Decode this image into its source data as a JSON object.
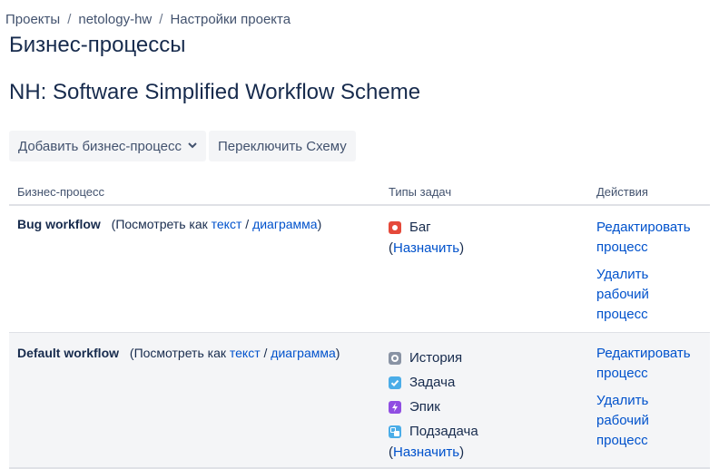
{
  "breadcrumb": {
    "items": [
      "Проекты",
      "netology-hw",
      "Настройки проекта"
    ],
    "separator": "/"
  },
  "page_title": "Бизнес-процессы",
  "scheme_title": "NH: Software Simplified Workflow Scheme",
  "toolbar": {
    "add_label": "Добавить бизнес-процесс",
    "switch_label": "Переключить Схему"
  },
  "table": {
    "headers": [
      "Бизнес-процесс",
      "Типы задач",
      "Действия"
    ],
    "view_prefix": "(Посмотреть как",
    "view_text": "текст",
    "view_sep": "/",
    "view_diagram": "диаграмма",
    "view_suffix": ")",
    "assign_open": "(",
    "assign_link": "Назначить",
    "assign_close": ")",
    "edit_label_1": "Редактировать",
    "edit_label_2": "процесс",
    "delete_label_1": "Удалить",
    "delete_label_2": "рабочий",
    "delete_label_3": "процесс",
    "rows": [
      {
        "name": "Bug workflow",
        "issue_types": [
          {
            "label": "Баг",
            "icon": "bug-icon",
            "color": "#e5493a"
          }
        ]
      },
      {
        "name": "Default workflow",
        "issue_types": [
          {
            "label": "История",
            "icon": "story-icon",
            "color": "#8993a4"
          },
          {
            "label": "Задача",
            "icon": "task-icon",
            "color": "#4bade8"
          },
          {
            "label": "Эпик",
            "icon": "epic-icon",
            "color": "#904ee2"
          },
          {
            "label": "Подзадача",
            "icon": "subtask-icon",
            "color": "#4bade8"
          }
        ]
      }
    ]
  }
}
